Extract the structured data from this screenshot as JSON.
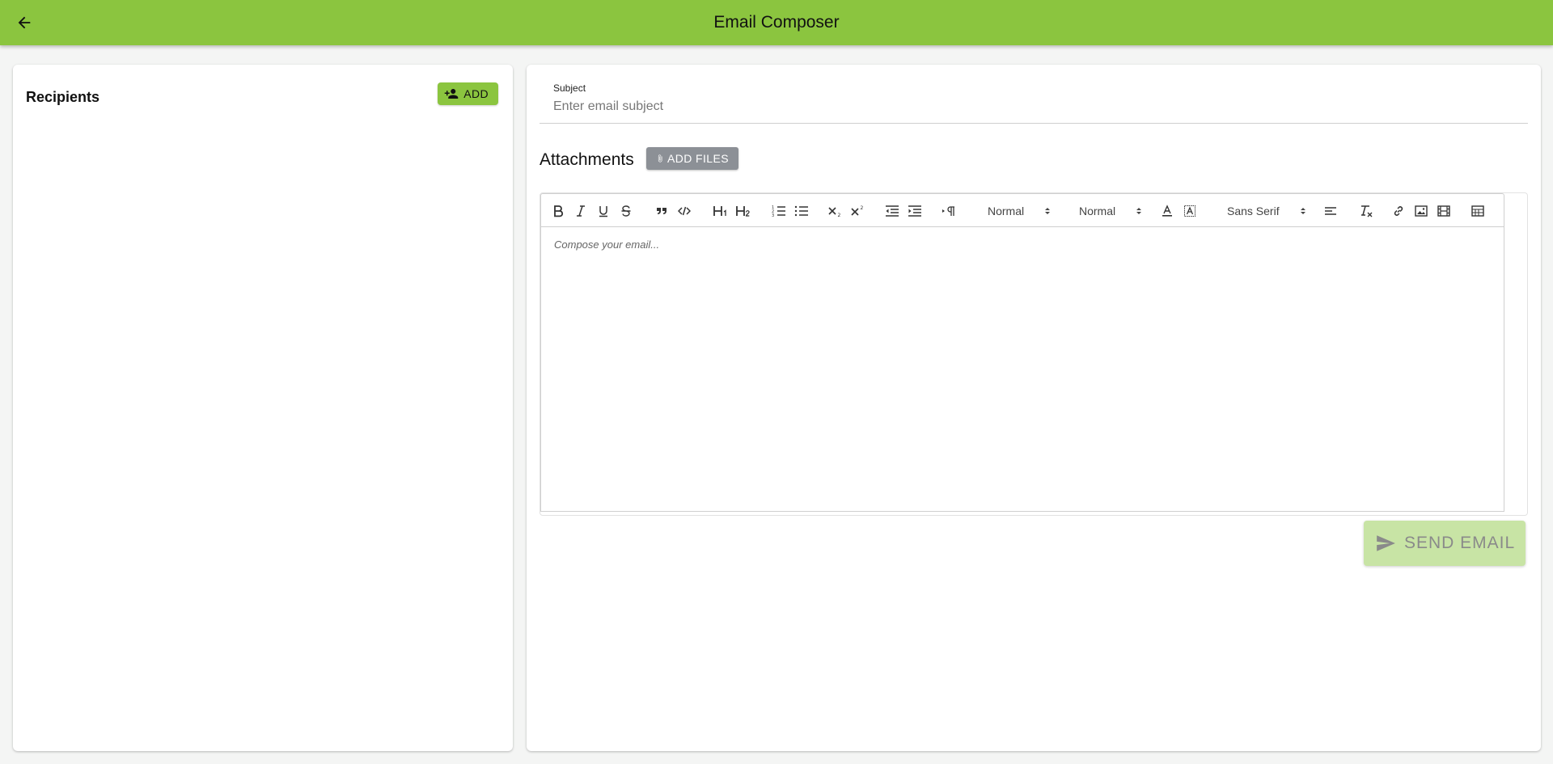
{
  "appbar": {
    "title": "Email Composer",
    "back_icon": "arrow-left-icon",
    "color": "#8bc53f"
  },
  "recipients": {
    "title": "Recipients",
    "add_label": "ADD",
    "add_icon": "person-add-icon"
  },
  "subject": {
    "label": "Subject",
    "placeholder": "Enter email subject",
    "value": ""
  },
  "attachments": {
    "title": "Attachments",
    "add_files_label": "ADD FILES",
    "add_files_icon": "paperclip-icon"
  },
  "editor": {
    "placeholder": "Compose your email...",
    "toolbar": {
      "size_value": "Normal",
      "header_value": "Normal",
      "font_value": "Sans Serif",
      "buttons": [
        "bold",
        "italic",
        "underline",
        "strike",
        "blockquote",
        "code-block",
        "header-1",
        "header-2",
        "ordered-list",
        "bullet-list",
        "subscript",
        "superscript",
        "outdent",
        "indent",
        "direction",
        "color",
        "background",
        "align",
        "clean",
        "link",
        "image",
        "video",
        "table"
      ]
    }
  },
  "send": {
    "label": "SEND EMAIL",
    "icon": "send-icon",
    "disabled": true
  }
}
